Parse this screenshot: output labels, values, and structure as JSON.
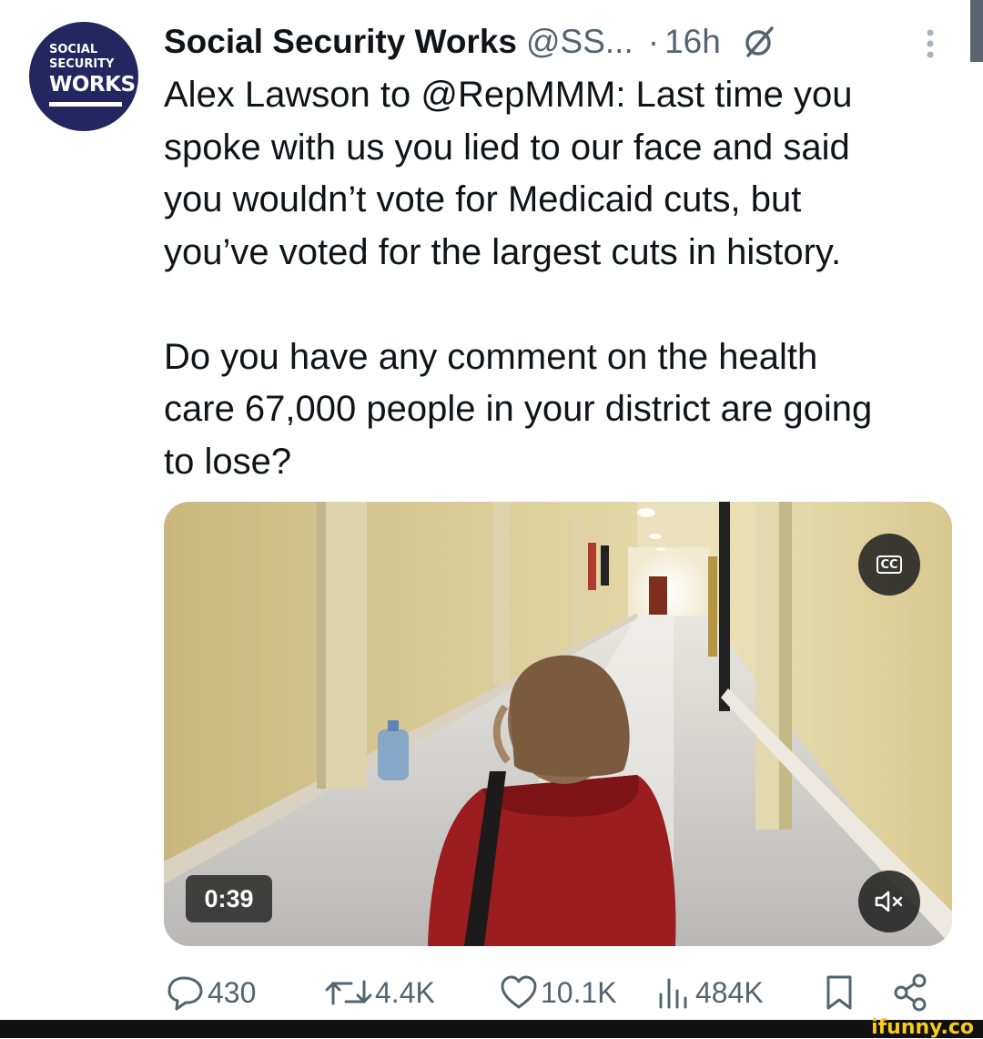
{
  "author": {
    "avatar": {
      "line1": "SOCIAL",
      "line2": "SECURITY",
      "line3": "WORKS."
    },
    "name": "Social Security Works",
    "handle": "@SS...",
    "dot": "·",
    "time": "16h"
  },
  "tweet": {
    "text": "Alex Lawson to @RepMMM: Last time you\nspoke with us you lied to our face and said\nyou wouldn’t vote for Medicaid cuts, but\nyou’ve voted for the largest cuts in history.\n\nDo you have any comment on the health\ncare 67,000 people in your district are going\nto lose?"
  },
  "video": {
    "duration": "0:39",
    "cc_label": "CC",
    "icons": [
      "closed-captions-icon",
      "volume-muted-icon"
    ]
  },
  "actions": {
    "replies": "430",
    "reposts": "4.4K",
    "likes": "10.1K",
    "views": "484K"
  },
  "colors": {
    "secondary_text": "#536471",
    "avatar_bg": "#23265f",
    "watermark": "#f8cb1e"
  },
  "watermark": "ifunny.co"
}
